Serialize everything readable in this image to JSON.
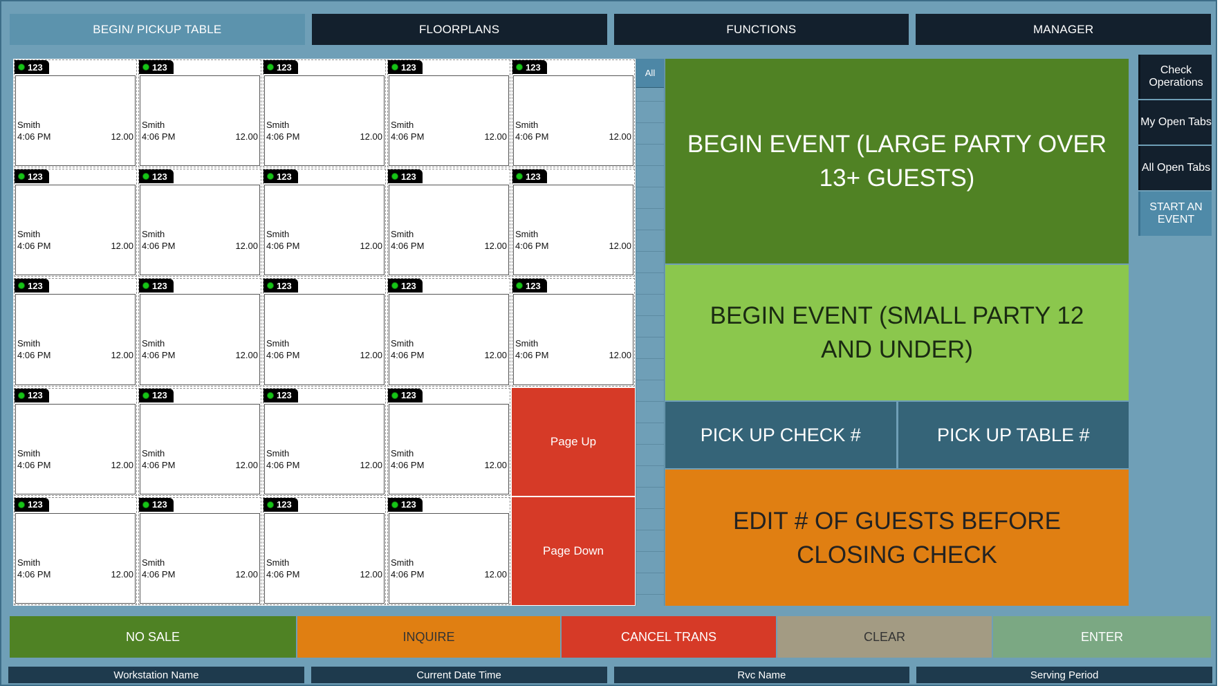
{
  "top_tabs": [
    {
      "label": "BEGIN/ PICKUP TABLE",
      "active": true
    },
    {
      "label": "FLOORPLANS",
      "active": false
    },
    {
      "label": "FUNCTIONS",
      "active": false
    },
    {
      "label": "MANAGER",
      "active": false
    }
  ],
  "checks": [
    {
      "number": "123",
      "name": "Smith",
      "time": "4:06 PM",
      "amount": "12.00"
    },
    {
      "number": "123",
      "name": "Smith",
      "time": "4:06 PM",
      "amount": "12.00"
    },
    {
      "number": "123",
      "name": "Smith",
      "time": "4:06 PM",
      "amount": "12.00"
    },
    {
      "number": "123",
      "name": "Smith",
      "time": "4:06 PM",
      "amount": "12.00"
    },
    {
      "number": "123",
      "name": "Smith",
      "time": "4:06 PM",
      "amount": "12.00"
    },
    {
      "number": "123",
      "name": "Smith",
      "time": "4:06 PM",
      "amount": "12.00"
    },
    {
      "number": "123",
      "name": "Smith",
      "time": "4:06 PM",
      "amount": "12.00"
    },
    {
      "number": "123",
      "name": "Smith",
      "time": "4:06 PM",
      "amount": "12.00"
    },
    {
      "number": "123",
      "name": "Smith",
      "time": "4:06 PM",
      "amount": "12.00"
    },
    {
      "number": "123",
      "name": "Smith",
      "time": "4:06 PM",
      "amount": "12.00"
    },
    {
      "number": "123",
      "name": "Smith",
      "time": "4:06 PM",
      "amount": "12.00"
    },
    {
      "number": "123",
      "name": "Smith",
      "time": "4:06 PM",
      "amount": "12.00"
    },
    {
      "number": "123",
      "name": "Smith",
      "time": "4:06 PM",
      "amount": "12.00"
    },
    {
      "number": "123",
      "name": "Smith",
      "time": "4:06 PM",
      "amount": "12.00"
    },
    {
      "number": "123",
      "name": "Smith",
      "time": "4:06 PM",
      "amount": "12.00"
    },
    {
      "number": "123",
      "name": "Smith",
      "time": "4:06 PM",
      "amount": "12.00"
    },
    {
      "number": "123",
      "name": "Smith",
      "time": "4:06 PM",
      "amount": "12.00"
    },
    {
      "number": "123",
      "name": "Smith",
      "time": "4:06 PM",
      "amount": "12.00"
    },
    {
      "number": "123",
      "name": "Smith",
      "time": "4:06 PM",
      "amount": "12.00"
    },
    {
      "number": "123",
      "name": "Smith",
      "time": "4:06 PM",
      "amount": "12.00"
    },
    {
      "number": "123",
      "name": "Smith",
      "time": "4:06 PM",
      "amount": "12.00"
    },
    {
      "number": "123",
      "name": "Smith",
      "time": "4:06 PM",
      "amount": "12.00"
    },
    {
      "number": "123",
      "name": "Smith",
      "time": "4:06 PM",
      "amount": "12.00"
    }
  ],
  "paging": {
    "page_up": "Page Up",
    "page_down": "Page Down"
  },
  "scroll": {
    "all_label": "All"
  },
  "events": {
    "large_party": "BEGIN EVENT (LARGE PARTY OVER 13+ GUESTS)",
    "small_party": "BEGIN EVENT (SMALL PARTY 12 AND UNDER)",
    "pick_check": "PICK UP CHECK #",
    "pick_table": "PICK UP TABLE  #",
    "edit_guests": "EDIT # OF GUESTS BEFORE CLOSING CHECK"
  },
  "side_nav": [
    {
      "label": "Check Operations"
    },
    {
      "label": "My Open Tabs"
    },
    {
      "label": "All Open Tabs"
    },
    {
      "label": "START AN EVENT"
    }
  ],
  "actions": {
    "no_sale": "NO SALE",
    "inquire": "INQUIRE",
    "cancel": "CANCEL TRANS",
    "clear": "CLEAR",
    "enter": "ENTER"
  },
  "status_bar": {
    "workstation": "Workstation Name",
    "datetime": "Current Date Time",
    "rvc": "Rvc Name",
    "period": "Serving Period"
  },
  "colors": {
    "background": "#6f9fb7",
    "dark_nav": "#13202d",
    "green_dark": "#508224",
    "green_light": "#8bc74d",
    "blue": "#356478",
    "orange": "#e07f12",
    "red": "#d63a27",
    "tan": "#a39b83",
    "sage": "#7ba883"
  }
}
